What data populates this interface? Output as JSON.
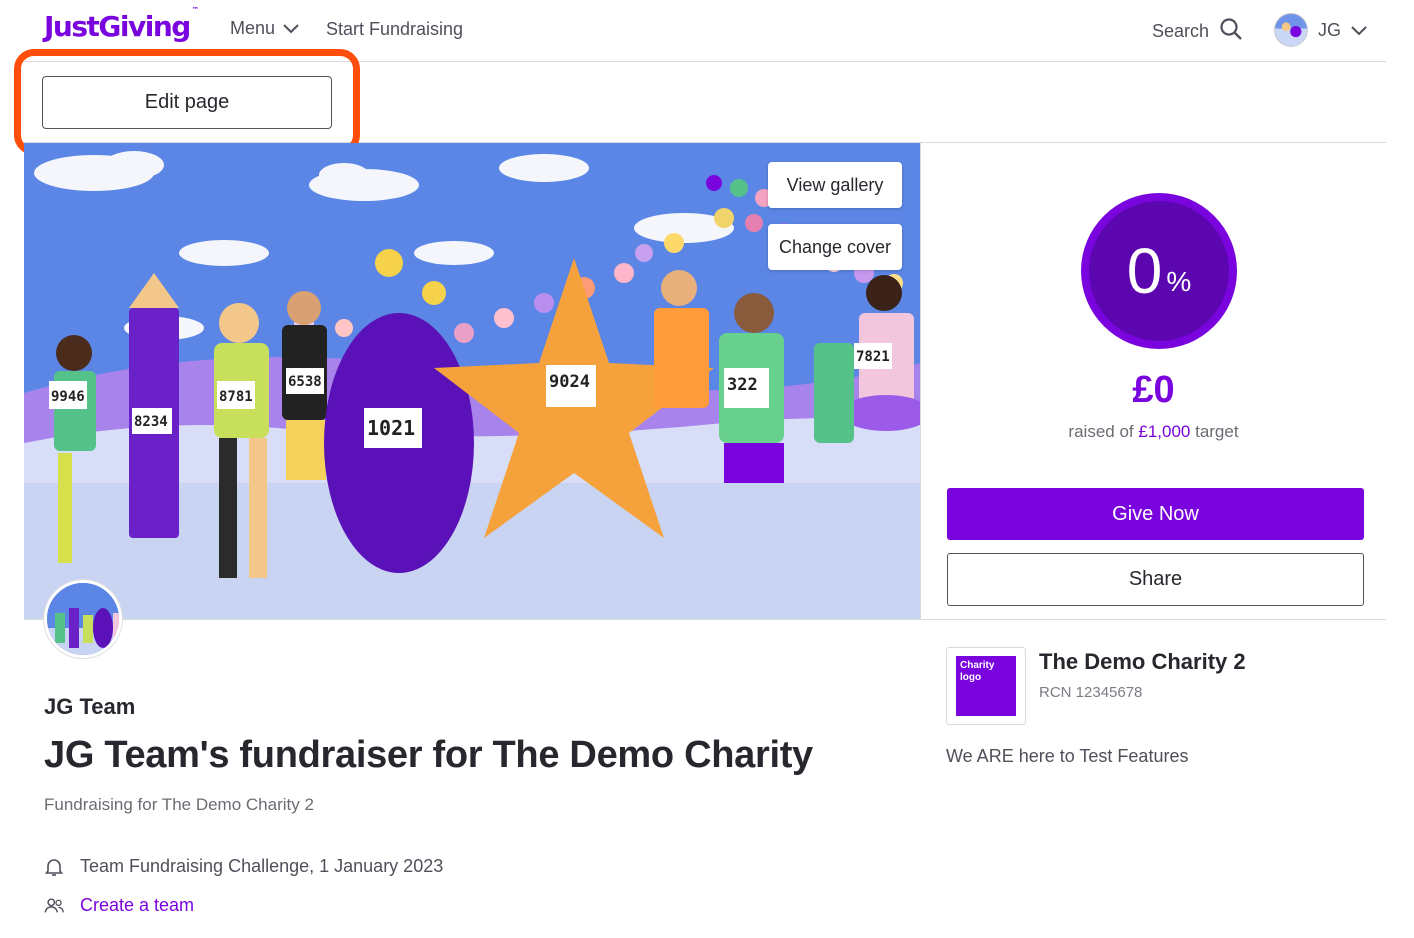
{
  "header": {
    "logo_text": "JustGiving",
    "logo_tm": "™",
    "menu_label": "Menu",
    "start_label": "Start Fundraising",
    "search_label": "Search",
    "account_initials": "JG"
  },
  "toolbar": {
    "edit_label": "Edit page"
  },
  "hero": {
    "view_gallery_label": "View gallery",
    "change_cover_label": "Change cover",
    "bib_numbers": [
      "9946",
      "8234",
      "8781",
      "6538",
      "1021",
      "9024",
      "322",
      "7821"
    ]
  },
  "progress": {
    "percent": "0",
    "percent_sign": "%",
    "percent_value": 0,
    "raised": "£0",
    "target_prefix": "raised of",
    "target_amount": "£1,000",
    "target_suffix": "target",
    "give_label": "Give Now",
    "share_label": "Share"
  },
  "page": {
    "team_name": "JG Team",
    "title": "JG Team's fundraiser for The Demo Charity",
    "subtitle": "Fundraising for The Demo Charity 2",
    "event": "Team Fundraising Challenge, 1 January 2023",
    "create_team": "Create a team"
  },
  "charity": {
    "logo_text": "Charity logo",
    "name": "The Demo Charity 2",
    "rcn": "RCN 12345678",
    "description": "We ARE here to Test Features"
  },
  "colors": {
    "brand_purple": "#7a04dd",
    "highlight_orange": "#ff4e0c"
  }
}
